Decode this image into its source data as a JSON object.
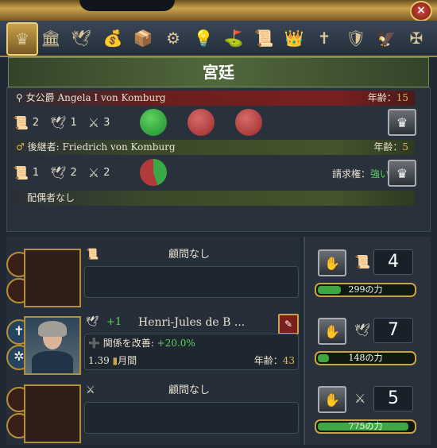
{
  "title": "宮廷",
  "close_label": "×",
  "ruler": {
    "name": "女公爵 Angela I von Komburg",
    "age_label": "年齢：",
    "age": "15",
    "adm": "2",
    "dip": "1",
    "mil": "3"
  },
  "heir": {
    "name": "後継者: Friedrich von Komburg",
    "age_label": "年齢：",
    "age": "5",
    "adm": "1",
    "dip": "2",
    "mil": "2",
    "claim_label": "請求権：",
    "claim": "強い"
  },
  "consort": {
    "label": "配偶者なし"
  },
  "advisors": [
    {
      "name": "顧問なし",
      "type_icon": "scroll-icon"
    },
    {
      "name": "Henri-Jules de B ...",
      "bonus": "+1",
      "effect_label": "関係を改善: ",
      "effect_value": "+20.0%",
      "cost": "1.39",
      "cost_unit": "月間",
      "age_label": "年齢：",
      "age": "43",
      "type_icon": "dove-icon"
    },
    {
      "name": "顧問なし",
      "type_icon": "swords-icon"
    }
  ],
  "power": [
    {
      "value": "4",
      "bar_label": "299の力",
      "fill": 0.24
    },
    {
      "value": "7",
      "bar_label": "148の力",
      "fill": 0.12
    },
    {
      "value": "5",
      "bar_label": "775の力",
      "fill": 0.95
    }
  ],
  "colors": {
    "accent": "#c9a24a",
    "red": "#7a2020",
    "green": "#44542c"
  }
}
